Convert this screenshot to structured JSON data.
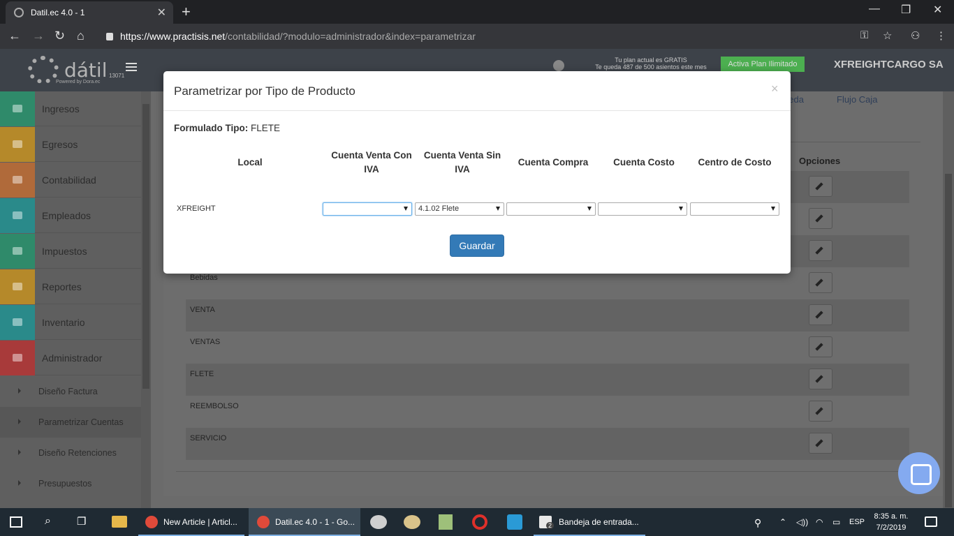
{
  "browser": {
    "tab_title": "Datil.ec 4.0 - 1",
    "url_host": "https://www.practisis.net",
    "url_path": "/contabilidad/?modulo=administrador&index=parametrizar"
  },
  "header": {
    "logo_text": "dátil",
    "logo_powered": "Powered by Dora.ec",
    "logo_number": "13071",
    "plan_line1": "Tu plan actual es GRATIS",
    "plan_line2": "Te queda 487 de 500 asientos este mes",
    "plan_button": "Activa Plan Ilimitado",
    "company": "XFREIGHTCARGO SA"
  },
  "sidebar": {
    "items": [
      {
        "label": "Ingresos",
        "color": "#2f8a6a"
      },
      {
        "label": "Egresos",
        "color": "#b5892a"
      },
      {
        "label": "Contabilidad",
        "color": "#b06a3a"
      },
      {
        "label": "Empleados",
        "color": "#2a8a8a"
      },
      {
        "label": "Impuestos",
        "color": "#2f8a6a"
      },
      {
        "label": "Reportes",
        "color": "#b5892a"
      },
      {
        "label": "Inventario",
        "color": "#2a8a8a"
      },
      {
        "label": "Administrador",
        "color": "#a83a3a"
      }
    ],
    "subitems": [
      {
        "label": "Diseño Factura"
      },
      {
        "label": "Parametrizar Cuentas"
      },
      {
        "label": "Diseño Retenciones"
      },
      {
        "label": "Presupuestos"
      }
    ]
  },
  "main": {
    "topnav": [
      "neda",
      "Flujo Caja"
    ],
    "options_header": "Opciones",
    "rows": [
      "Bebidas",
      "VENTA",
      "VENTAS",
      "FLETE",
      "REEMBOLSO",
      "SERVICIO"
    ]
  },
  "modal": {
    "title": "Parametrizar por Tipo de Producto",
    "close": "×",
    "formulado_label": "Formulado Tipo:",
    "formulado_value": "FLETE",
    "headers": {
      "local": "Local",
      "venta_con_1": "Cuenta Venta Con",
      "venta_con_2": "IVA",
      "venta_sin_1": "Cuenta Venta Sin",
      "venta_sin_2": "IVA",
      "compra": "Cuenta Compra",
      "costo": "Cuenta Costo",
      "centro": "Centro de Costo"
    },
    "local_value": "XFREIGHT",
    "selects": {
      "venta_con": "",
      "venta_sin": "4.1.02 Flete",
      "compra": "",
      "costo": "",
      "centro": ""
    },
    "save_label": "Guardar"
  },
  "taskbar": {
    "apps": [
      {
        "label": "New Article | Articl..."
      },
      {
        "label": "Datil.ec 4.0 - 1 - Go..."
      },
      {
        "label": "Bandeja de entrada..."
      }
    ],
    "mail_badge": "2",
    "language": "ESP",
    "time": "8:35 a. m.",
    "date": "7/2/2019"
  }
}
